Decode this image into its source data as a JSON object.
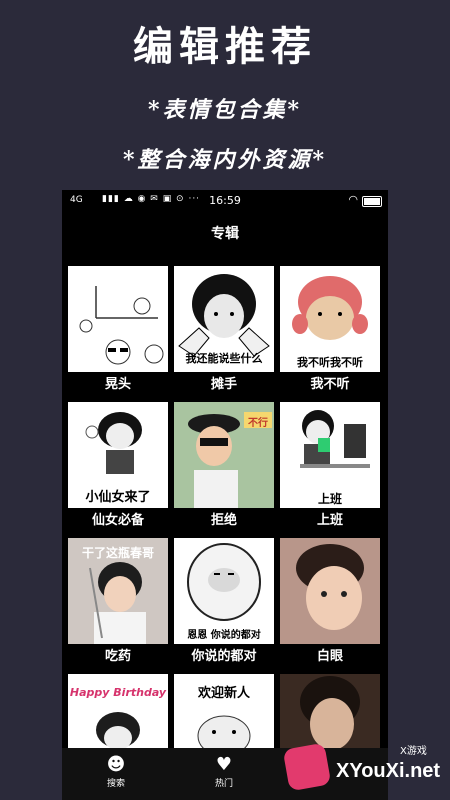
{
  "promo": {
    "title": "编辑推荐",
    "subtitle1": "*表情包合集*",
    "subtitle2": "*整合海内外资源*"
  },
  "status": {
    "network": "4G",
    "time": "16:59"
  },
  "navbar": {
    "title": "专辑"
  },
  "items": [
    {
      "caption": "晃头",
      "overlay": ""
    },
    {
      "caption": "摊手",
      "overlay": "我还能说些什么"
    },
    {
      "caption": "我不听",
      "overlay": "我不听我不听"
    },
    {
      "caption": "仙女必备",
      "overlay": "小仙女来了"
    },
    {
      "caption": "拒绝",
      "overlay": "不行"
    },
    {
      "caption": "上班",
      "overlay": "上班"
    },
    {
      "caption": "吃药",
      "overlay": "干了这瓶春哥"
    },
    {
      "caption": "你说的都对",
      "overlay": "恩恩 你说的都对"
    },
    {
      "caption": "白眼",
      "overlay": ""
    },
    {
      "caption": "",
      "overlay": "Happy Birthday"
    },
    {
      "caption": "",
      "overlay": "欢迎新人"
    },
    {
      "caption": "",
      "overlay": ""
    }
  ],
  "tabbar": {
    "search_label": "搜索",
    "hot_label": "热门"
  },
  "watermark": {
    "small": "X游戏",
    "text": "XYouXi.net"
  }
}
